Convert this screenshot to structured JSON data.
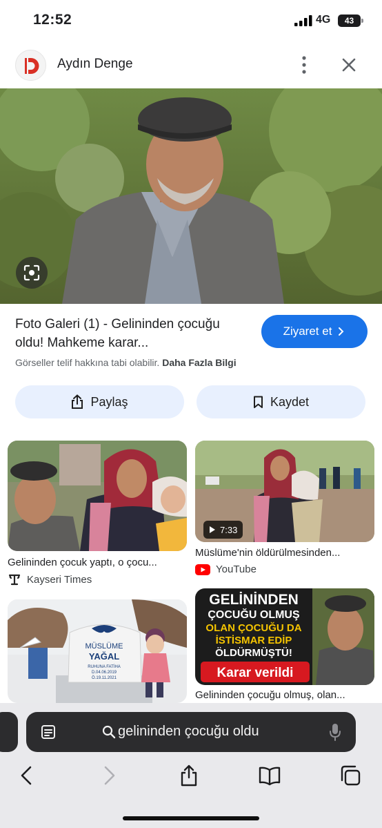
{
  "status_bar": {
    "time": "12:52",
    "network": "4G",
    "battery": "43"
  },
  "header": {
    "site_name": "Aydın Denge",
    "logo_icon": "aydin-denge-logo-icon",
    "more_icon": "more-vert-icon",
    "close_icon": "close-icon"
  },
  "result": {
    "title": "Foto Galeri (1) - Gelininden çocuğu oldu! Mahkeme karar...",
    "visit_label": "Ziyaret et",
    "copyright_text": "Görseller telif hakkına tabi olabilir.",
    "more_info_label": "Daha Fazla Bilgi",
    "share_label": "Paylaş",
    "save_label": "Kaydet"
  },
  "related": [
    {
      "caption": "Gelininden çocuk yaptı, o çocu...",
      "source": "Kayseri Times",
      "source_icon": "kayseri-times-icon"
    },
    {
      "caption": "Müslüme'nin öldürülmesinden...",
      "source": "YouTube",
      "source_icon": "youtube-icon",
      "duration": "7:33"
    },
    {
      "caption": "",
      "source": "",
      "grave_name": "MÜSLÜME",
      "grave_surname": "YAĞAL",
      "grave_fatiha": "RUHUNA FATİHA",
      "grave_birth": "D.04.06.2019",
      "grave_death": "Ö.19.11.2021"
    },
    {
      "caption": "Gelininden çocuğu olmuş, olan...",
      "source": "",
      "headline_lines": [
        "GELİNİNDEN",
        "ÇOCUĞU OLMUŞ",
        "OLAN ÇOCUĞU DA",
        "İSTİSMAR EDİP",
        "ÖLDÜRMÜŞTÜ!"
      ],
      "headline_banner": "Karar verildi"
    }
  ],
  "browser": {
    "search_query": "gelininden çocuğu oldu",
    "back_icon": "back-arrow-icon",
    "forward_icon": "forward-arrow-icon",
    "share_icon": "share-icon",
    "bookmarks_icon": "book-icon",
    "tabs_icon": "tabs-icon"
  },
  "colors": {
    "accent": "#1a73e8",
    "tonal_button": "#e8f0fe",
    "youtube_red": "#ff0000",
    "logo_red": "#d93025"
  }
}
